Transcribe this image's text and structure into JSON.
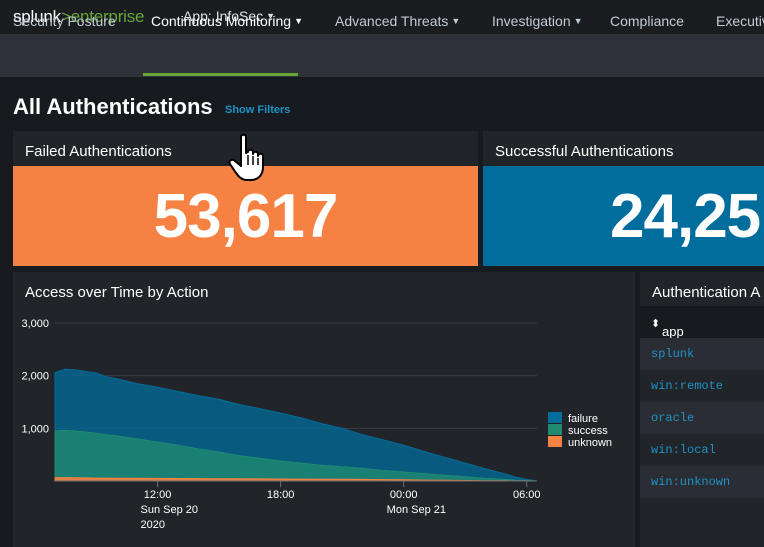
{
  "header": {
    "logo_main": "splunk",
    "logo_arrow": ">",
    "logo_product": "enterprise",
    "app_label": "App: InfoSec"
  },
  "nav": {
    "items": [
      {
        "label": "Security Posture",
        "dropdown": false,
        "active": false
      },
      {
        "label": "Continuous Monitoring",
        "dropdown": true,
        "active": true
      },
      {
        "label": "Advanced Threats",
        "dropdown": true,
        "active": false
      },
      {
        "label": "Investigation",
        "dropdown": true,
        "active": false
      },
      {
        "label": "Compliance",
        "dropdown": false,
        "active": false
      },
      {
        "label": "Executiv",
        "dropdown": false,
        "active": false
      }
    ]
  },
  "page": {
    "title": "All Authentications",
    "show_filters": "Show Filters"
  },
  "panels": {
    "failed": {
      "title": "Failed Authentications",
      "value": "53,617",
      "color": "#f58142"
    },
    "successful": {
      "title": "Successful Authentications",
      "value": "24,25",
      "color": "#006d9c"
    },
    "chart": {
      "title": "Access over Time by Action"
    },
    "table": {
      "title": "Authentication A",
      "column_header": "app",
      "rows": [
        "splunk",
        "win:remote",
        "oracle",
        "win:local",
        "win:unknown"
      ]
    }
  },
  "colors": {
    "accent_green": "#65a637",
    "link_blue": "#1e93c6",
    "failure": "#006d9c",
    "success": "#1f8a70",
    "unknown": "#f58142"
  },
  "chart_data": {
    "type": "area",
    "stacked": false,
    "y_ticks": [
      "3,000",
      "2,000",
      "1,000"
    ],
    "ylim": [
      0,
      3000
    ],
    "x_ticks": [
      {
        "line1": "12:00",
        "line2": "Sun Sep 20",
        "line3": "2020"
      },
      {
        "line1": "18:00",
        "line2": "",
        "line3": ""
      },
      {
        "line1": "00:00",
        "line2": "Mon Sep 21",
        "line3": ""
      },
      {
        "line1": "06:00",
        "line2": "",
        "line3": ""
      }
    ],
    "x_hours": [
      7,
      7.5,
      8,
      8.5,
      9,
      9.5,
      10,
      11,
      12,
      13,
      14,
      15,
      16,
      17,
      18,
      19,
      20,
      21,
      22,
      23,
      24,
      25,
      26,
      27,
      28,
      29,
      29.5,
      30,
      30.5
    ],
    "series": [
      {
        "name": "failure",
        "values": [
          2060,
          2120,
          2110,
          2080,
          2050,
          1980,
          1940,
          1850,
          1780,
          1700,
          1620,
          1550,
          1450,
          1370,
          1290,
          1200,
          1090,
          1000,
          880,
          780,
          680,
          560,
          450,
          340,
          230,
          130,
          70,
          30,
          0
        ]
      },
      {
        "name": "success",
        "values": [
          950,
          960,
          950,
          930,
          910,
          880,
          860,
          800,
          740,
          680,
          610,
          550,
          480,
          430,
          380,
          340,
          300,
          270,
          240,
          200,
          170,
          140,
          110,
          80,
          50,
          30,
          15,
          5,
          0
        ]
      },
      {
        "name": "unknown",
        "values": [
          60,
          65,
          60,
          58,
          56,
          55,
          54,
          52,
          50,
          48,
          46,
          44,
          42,
          40,
          38,
          36,
          34,
          32,
          30,
          26,
          22,
          18,
          14,
          10,
          6,
          4,
          2,
          1,
          0
        ]
      }
    ],
    "legend": [
      "failure",
      "success",
      "unknown"
    ],
    "legend_position": "right",
    "grid": true
  }
}
